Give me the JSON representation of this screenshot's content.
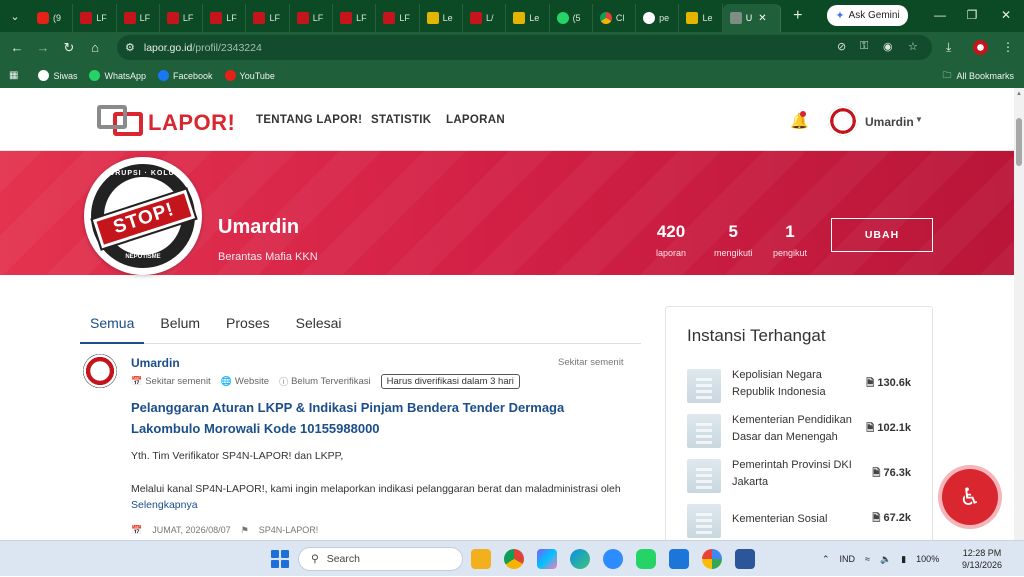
{
  "browser": {
    "tabs": [
      {
        "label": "(9",
        "fav": "yt"
      },
      {
        "label": "LF",
        "fav": "lf"
      },
      {
        "label": "LF",
        "fav": "lf"
      },
      {
        "label": "LF",
        "fav": "lf"
      },
      {
        "label": "LF",
        "fav": "lf"
      },
      {
        "label": "LF",
        "fav": "lf"
      },
      {
        "label": "LF",
        "fav": "lf"
      },
      {
        "label": "LF",
        "fav": "lf"
      },
      {
        "label": "LF",
        "fav": "lf"
      },
      {
        "label": "Le",
        "fav": "le"
      },
      {
        "label": "L/",
        "fav": "lf"
      },
      {
        "label": "Le",
        "fav": "le"
      },
      {
        "label": "(5",
        "fav": "wa"
      },
      {
        "label": "Cl",
        "fav": "ch"
      },
      {
        "label": "pe",
        "fav": "gg"
      },
      {
        "label": "Le",
        "fav": "le"
      }
    ],
    "active_tab": {
      "label": "U"
    },
    "ask_gemini": "Ask Gemini",
    "url_host": "lapor.go.id",
    "url_path": "/profil/2343224",
    "bookmarks": [
      {
        "label": "Siwas",
        "color": "#ffffff"
      },
      {
        "label": "WhatsApp",
        "color": "#25d366"
      },
      {
        "label": "Facebook",
        "color": "#1877f2"
      },
      {
        "label": "YouTube",
        "color": "#e62117"
      }
    ],
    "all_bookmarks": "All Bookmarks"
  },
  "site": {
    "logo_text": "LAPOR!",
    "nav": [
      "TENTANG LAPOR!",
      "STATISTIK",
      "LAPORAN"
    ],
    "user_name": "Umardin"
  },
  "profile": {
    "name": "Umardin",
    "bio": "Berantas Mafia KKN",
    "avatar_text": {
      "top": "KORUPSI · KOLUSI",
      "middle": "STOP!",
      "bottom": "NEPOTISME"
    },
    "stats": [
      {
        "value": "420",
        "label": "laporan"
      },
      {
        "value": "5",
        "label": "mengikuti"
      },
      {
        "value": "1",
        "label": "pengikut"
      }
    ],
    "edit_label": "UBAH"
  },
  "filters": [
    "Semua",
    "Belum",
    "Proses",
    "Selesai"
  ],
  "post": {
    "author": "Umardin",
    "time": "Sekitar semenit",
    "meta": [
      "Sekitar semenit",
      "Website",
      "Belum Terverifikasi"
    ],
    "verify_badge": "Harus diverifikasi dalam 3 hari",
    "title": "Pelanggaran Aturan LKPP & Indikasi Pinjam Bendera Tender Dermaga Lakombulo Morowali Kode 10155988000",
    "line1": "Yth. Tim Verifikator SP4N-LAPOR! dan LKPP,",
    "line2": "Melalui kanal SP4N-LAPOR!, kami ingin melaporkan indikasi pelanggaran berat dan maladministrasi oleh",
    "read_more": "Selengkapnya",
    "date": "JUMAT, 2026/08/07",
    "channel": "SP4N-LAPOR!"
  },
  "sidebar": {
    "title": "Instansi Terhangat",
    "items": [
      {
        "name": "Kepolisian Negara Republik Indonesia",
        "count": "130.6k"
      },
      {
        "name": "Kementerian Pendidikan Dasar dan Menengah",
        "count": "102.1k"
      },
      {
        "name": "Pemerintah Provinsi DKI Jakarta",
        "count": "76.3k"
      },
      {
        "name": "Kementerian Sosial",
        "count": "67.2k"
      }
    ]
  },
  "taskbar": {
    "search_placeholder": "Search",
    "lang": "IND",
    "battery": "100%",
    "time": "12:28 PM",
    "date": "9/13/2026"
  },
  "colors": {
    "accent": "#d9262f",
    "banner": "#d42146",
    "link": "#1b4e8a",
    "chrome": "#1f5f39"
  }
}
